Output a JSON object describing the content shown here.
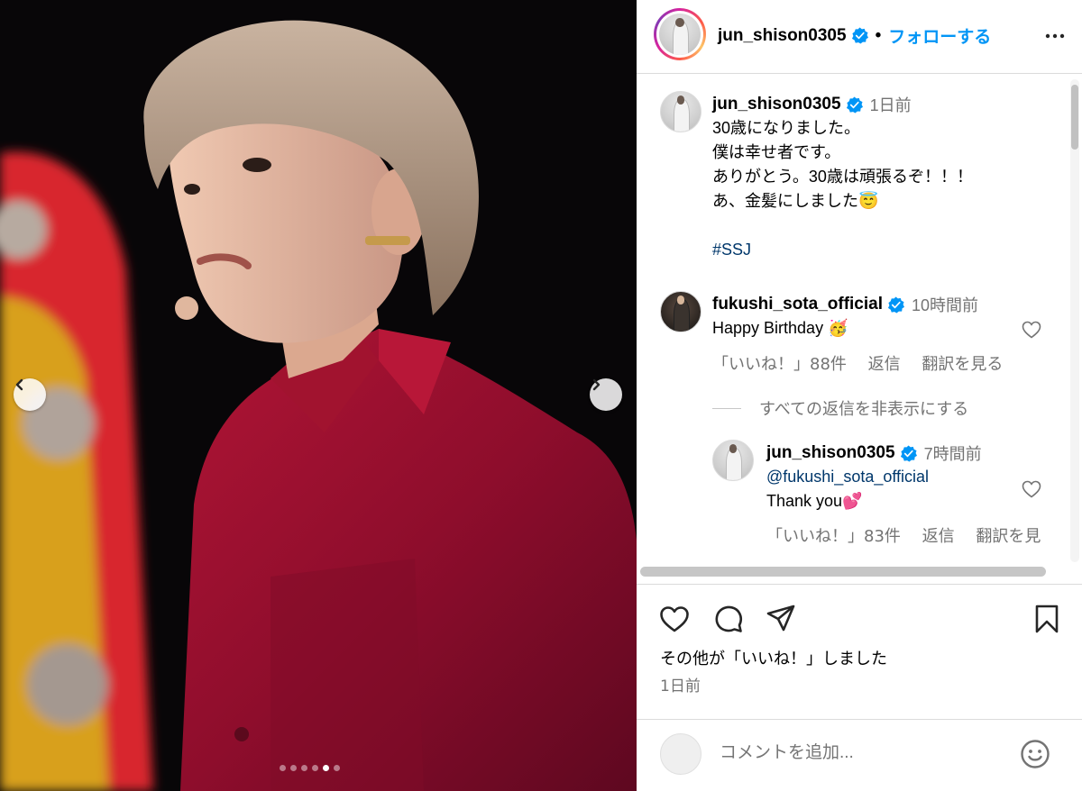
{
  "post": {
    "username": "jun_shison0305",
    "follow_label": "フォローする",
    "separator": "•",
    "caption_time": "1日前",
    "caption_lines": [
      "30歳になりました。",
      "僕は幸せ者です。",
      "ありがとう。30歳は頑張るぞ！！！",
      "あ、金髪にしました😇"
    ],
    "hashtag": "#SSJ"
  },
  "comments": [
    {
      "username": "fukushi_sota_official",
      "time": "10時間前",
      "text": "Happy Birthday 🥳",
      "likes": "「いいね！」88件",
      "reply": "返信",
      "translate": "翻訳を見る"
    }
  ],
  "hide_replies_label": "すべての返信を非表示にする",
  "replies": [
    {
      "username": "jun_shison0305",
      "time": "7時間前",
      "mention": "@fukushi_sota_official",
      "text": "Thank you💕",
      "likes": "「いいね！」83件",
      "reply": "返信",
      "translate": "翻訳を見"
    }
  ],
  "footer": {
    "likes_text": "その他が「いいね！」しました",
    "date": "1日前",
    "comment_placeholder": "コメントを追加..."
  },
  "carousel": {
    "total": 6,
    "active_index": 4
  },
  "colors": {
    "link": "#0095f6",
    "hashtag": "#00376b",
    "muted": "#737373",
    "verified": "#0095f6"
  },
  "icons": [
    "chevron-left-icon",
    "chevron-right-icon",
    "verified-icon",
    "more-icon",
    "heart-icon",
    "comment-icon",
    "share-icon",
    "bookmark-icon",
    "emoji-icon"
  ]
}
